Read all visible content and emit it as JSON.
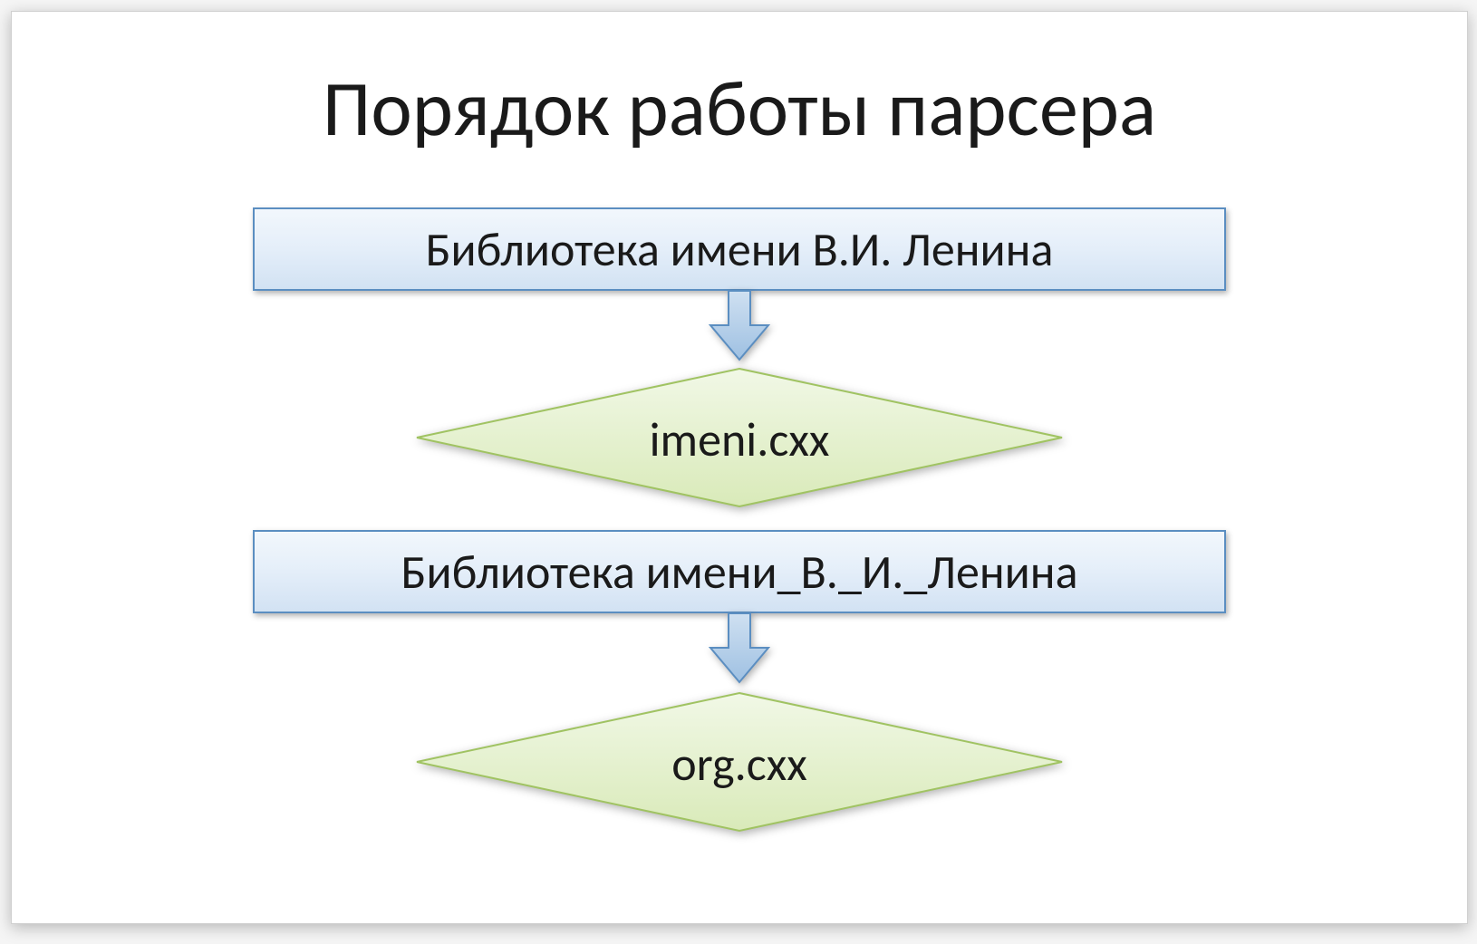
{
  "title": "Порядок работы парсера",
  "flowchart": {
    "step1": {
      "type": "process",
      "label": "Библиотека имени В.И. Ленина"
    },
    "step2": {
      "type": "decision",
      "label": "imeni.cxx"
    },
    "step3": {
      "type": "process",
      "label": "Библиотека имени_В._И._Ленина"
    },
    "step4": {
      "type": "decision",
      "label": "org.cxx"
    }
  },
  "colors": {
    "process_fill_top": "#f2f7fc",
    "process_fill_bottom": "#d2e2f3",
    "process_border": "#5b8ec1",
    "decision_fill_top": "#eef7e0",
    "decision_fill_bottom": "#dcedc1",
    "decision_border": "#a0c362",
    "arrow_fill_top": "#bfd5ec",
    "arrow_fill_bottom": "#9ec0e2",
    "arrow_border": "#5b8ec1"
  }
}
